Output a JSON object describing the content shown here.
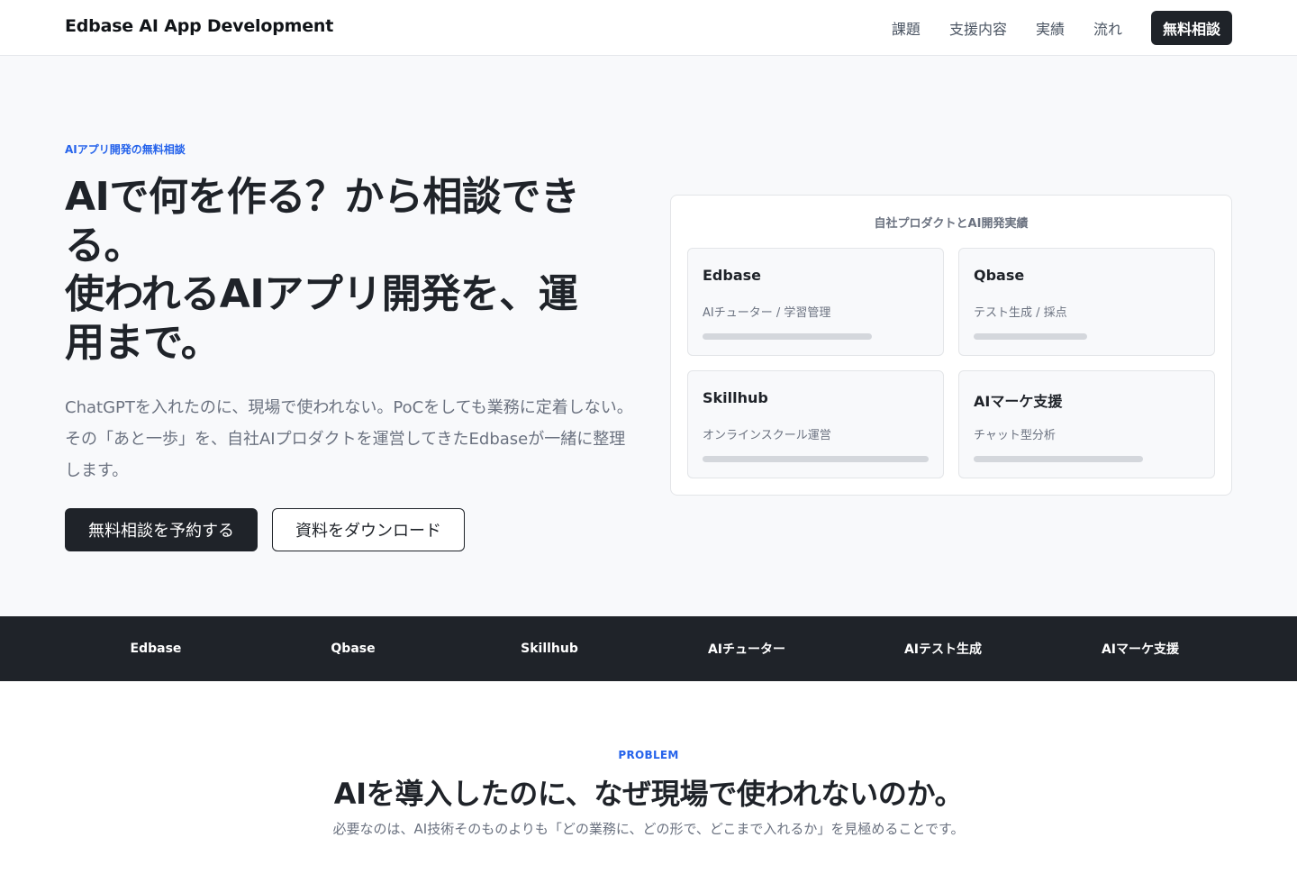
{
  "header": {
    "brand": "Edbase AI App Development",
    "nav": [
      "課題",
      "支援内容",
      "実績",
      "流れ"
    ],
    "cta": "無料相談"
  },
  "hero": {
    "eyebrow": "AIアプリ開発の無料相談",
    "title_lines": [
      "AIで何を作る？から相談でき",
      "る。",
      "使われるAIアプリ開発を、運",
      "用まで。"
    ],
    "lead": "ChatGPTを入れたのに、現場で使われない。PoCをしても業務に定着しない。その「あと一歩」を、自社AIプロダクトを運営してきたEdbaseが一緒に整理します。",
    "primary_button": "無料相談を予約する",
    "secondary_button": "資料をダウンロード"
  },
  "showcase": {
    "title": "自社プロダクトとAI開発実績",
    "cards": [
      {
        "name": "Edbase",
        "desc": "AIチューター / 学習管理",
        "bar_fraction": 0.75
      },
      {
        "name": "Qbase",
        "desc": "テスト生成 / 採点",
        "bar_fraction": 0.5
      },
      {
        "name": "Skillhub",
        "desc": "オンラインスクール運営",
        "bar_fraction": 1.0
      },
      {
        "name": "AIマーケ支援",
        "desc": "チャット型分析",
        "bar_fraction": 0.75
      }
    ]
  },
  "strip": {
    "items": [
      "Edbase",
      "Qbase",
      "Skillhub",
      "AIチューター",
      "AIテスト生成",
      "AIマーケ支援"
    ]
  },
  "problem": {
    "eyebrow": "PROBLEM",
    "title": "AIを導入したのに、なぜ現場で使われないのか。",
    "lead": "必要なのは、AI技術そのものよりも「どの業務に、どの形で、どこまで入れるか」を見極めることです。"
  }
}
